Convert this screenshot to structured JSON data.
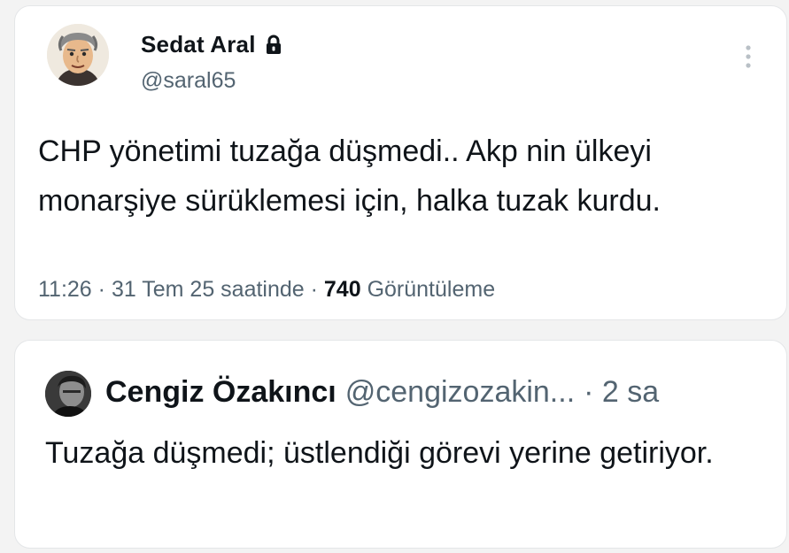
{
  "tweet": {
    "author_name": "Sedat Aral",
    "author_handle": "@saral65",
    "protected_icon": "lock-icon",
    "menu_icon": "more-vertical-icon",
    "text": "CHP yönetimi tuzağa düşmedi.. Akp nin ülkeyi monarşiye sürüklemesi için, halka tuzak kurdu.",
    "time": "11:26",
    "sep1": " · ",
    "date": "31 Tem 25 saatinde",
    "sep2": " · ",
    "views_count": "740",
    "views_label": "Görüntüleme"
  },
  "reply": {
    "author_name": "Cengiz Özakıncı",
    "author_handle": "@cengizozakin...",
    "time": "· 2 sa",
    "text": "Tuzağa düşmedi; üstlendiği görevi yerine getiriyor."
  },
  "colors": {
    "text_primary": "#0f1419",
    "text_secondary": "#536471",
    "card_border": "#e4e6e8",
    "background": "#f3f3f3"
  }
}
